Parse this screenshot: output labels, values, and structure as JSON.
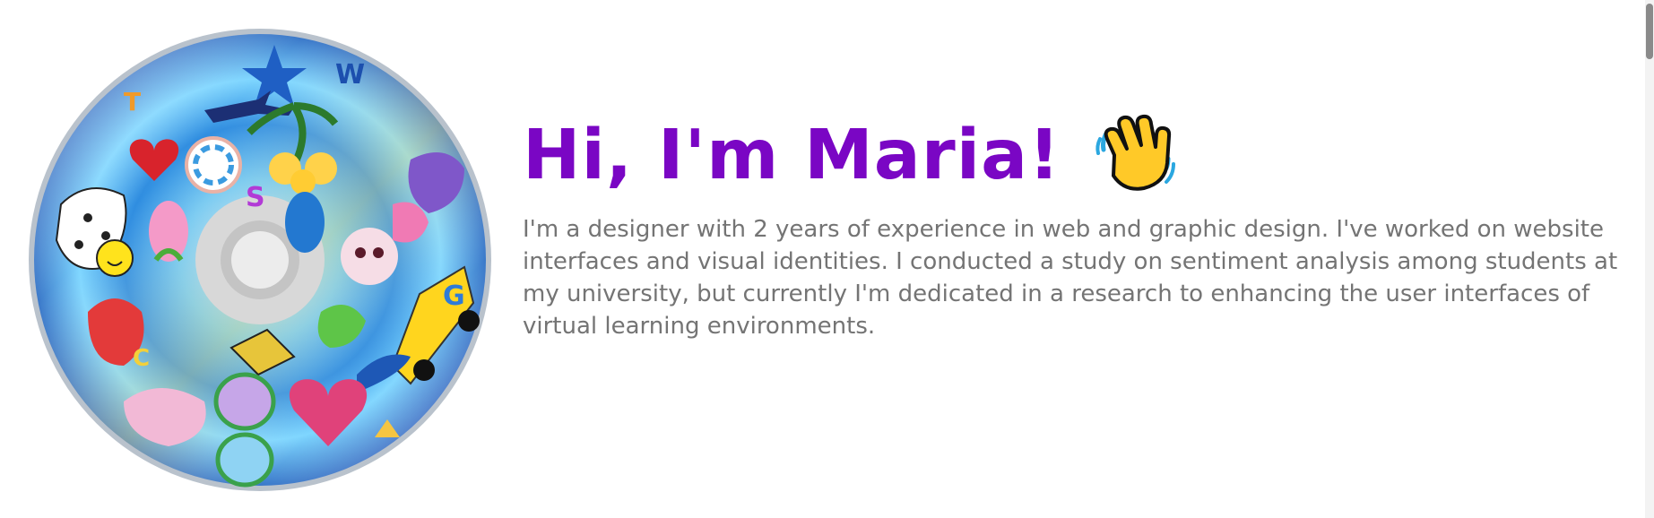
{
  "hero": {
    "heading": "Hi, I'm Maria!",
    "heading_icon": "waving-hand-icon",
    "bio": "I'm a designer with 2 years of experience in web and graphic design. I've worked on website interfaces and visual identities. I conducted a study on sentiment analysis among students at my university, but currently I'm dedicated in a research to enhancing the user interfaces of virtual learning environments.",
    "image": "sticker-covered-cd-image",
    "heading_color": "#7a06c4",
    "text_color": "#747474"
  }
}
